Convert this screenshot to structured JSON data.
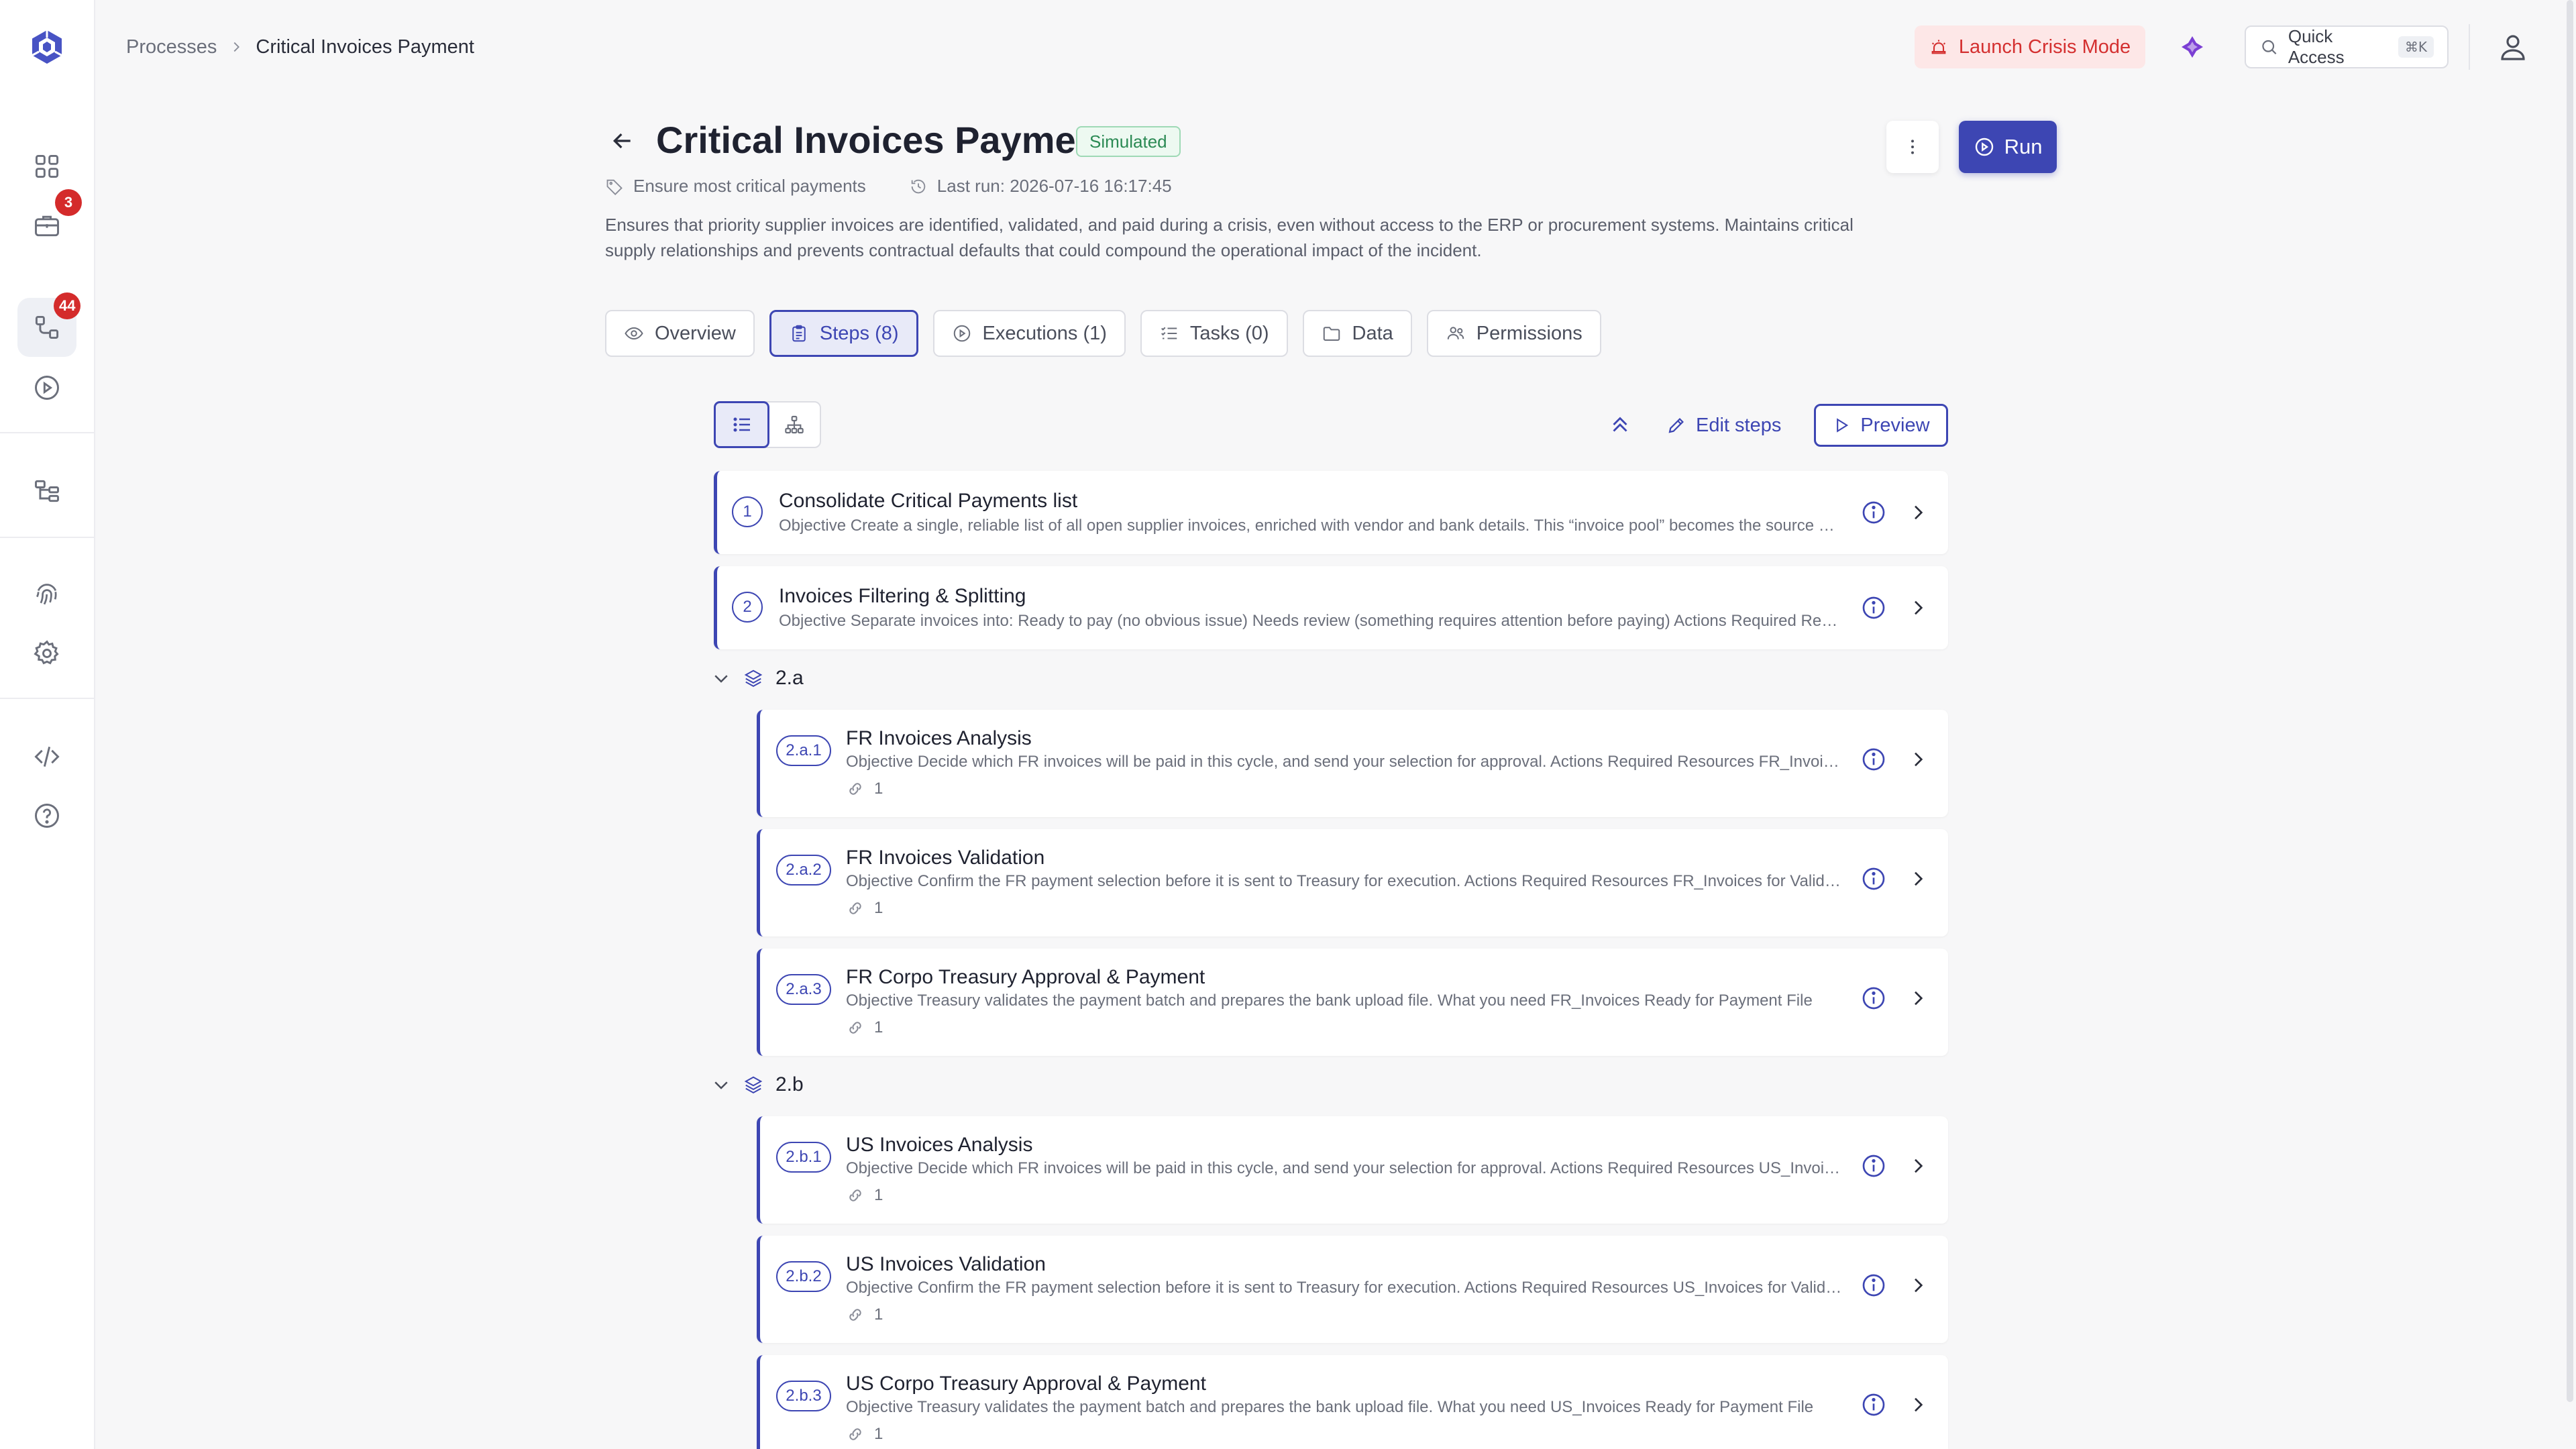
{
  "sidebar": {
    "items": [
      {
        "name": "dashboard",
        "icon": "grid-icon"
      },
      {
        "name": "briefcase",
        "icon": "briefcase-icon",
        "badge": "3"
      },
      {
        "name": "processes",
        "icon": "workflow-icon",
        "badge": "44",
        "active": true
      },
      {
        "name": "executions",
        "icon": "play-circle-icon"
      },
      {
        "name": "hierarchy",
        "icon": "hierarchy-icon"
      },
      {
        "name": "fingerprint",
        "icon": "fingerprint-icon"
      },
      {
        "name": "settings",
        "icon": "gear-icon"
      },
      {
        "name": "developer",
        "icon": "code-icon"
      },
      {
        "name": "help",
        "icon": "help-icon"
      }
    ]
  },
  "breadcrumb": {
    "parent": "Processes",
    "current": "Critical Invoices Payment"
  },
  "topbar": {
    "crisis_label": "Launch Crisis Mode",
    "quick_access_label": "Quick Access",
    "quick_access_shortcut": "⌘K"
  },
  "header": {
    "title": "Critical Invoices Payment",
    "status": "Simulated",
    "tag": "Ensure most critical payments",
    "last_run": "Last run: 2026-07-16 16:17:45",
    "description": "Ensures that priority supplier invoices are identified, validated, and paid during a crisis, even without access to the ERP or procurement systems. Maintains critical supply relationships and prevents contractual defaults that could compound the operational impact of the incident.",
    "run_label": "Run"
  },
  "tabs": [
    {
      "label": "Overview",
      "icon": "eye-icon"
    },
    {
      "label": "Steps (8)",
      "icon": "clipboard-icon",
      "active": true
    },
    {
      "label": "Executions (1)",
      "icon": "play-circle-icon"
    },
    {
      "label": "Tasks (0)",
      "icon": "checklist-icon"
    },
    {
      "label": "Data",
      "icon": "folder-icon"
    },
    {
      "label": "Permissions",
      "icon": "users-icon"
    }
  ],
  "toolbar": {
    "edit_label": "Edit steps",
    "preview_label": "Preview"
  },
  "steps": [
    {
      "num": "1",
      "title": "Consolidate Critical Payments list",
      "desc": "Objective Create a single, reliable list of all open supplier invoices, enriched with vendor and bank details. This “invoice pool” becomes the source of truth for every payment decision in this cycle."
    },
    {
      "num": "2",
      "title": "Invoices Filtering & Splitting",
      "desc": "Objective Separate invoices into: Ready to pay (no obvious issue) Needs review (something requires attention before paying) Actions Required Resources"
    }
  ],
  "groups": [
    {
      "label": "2.a",
      "steps": [
        {
          "num": "2.a.1",
          "title": "FR Invoices Analysis",
          "desc": "Objective Decide which FR invoices will be paid in this cycle, and send your selection for approval. Actions Required Resources FR_Invoices",
          "links": "1"
        },
        {
          "num": "2.a.2",
          "title": "FR Invoices Validation",
          "desc": "Objective Confirm the FR payment selection before it is sent to Treasury for execution. Actions Required Resources FR_Invoices for Validation",
          "links": "1"
        },
        {
          "num": "2.a.3",
          "title": "FR Corpo Treasury Approval & Payment",
          "desc": "Objective Treasury validates the payment batch and prepares the bank upload file. What you need FR_Invoices Ready for Payment File",
          "links": "1"
        }
      ]
    },
    {
      "label": "2.b",
      "steps": [
        {
          "num": "2.b.1",
          "title": "US Invoices Analysis",
          "desc": "Objective Decide which FR invoices will be paid in this cycle, and send your selection for approval. Actions Required Resources US_Invoices",
          "links": "1"
        },
        {
          "num": "2.b.2",
          "title": "US Invoices Validation",
          "desc": "Objective Confirm the FR payment selection before it is sent to Treasury for execution. Actions Required Resources US_Invoices for Validation",
          "links": "1"
        },
        {
          "num": "2.b.3",
          "title": "US Corpo Treasury Approval & Payment",
          "desc": "Objective Treasury validates the payment batch and prepares the bank upload file. What you need US_Invoices Ready for Payment File",
          "links": "1"
        }
      ]
    }
  ],
  "colors": {
    "accent": "#3d46b3",
    "danger": "#d43030",
    "success": "#2b8a54"
  }
}
